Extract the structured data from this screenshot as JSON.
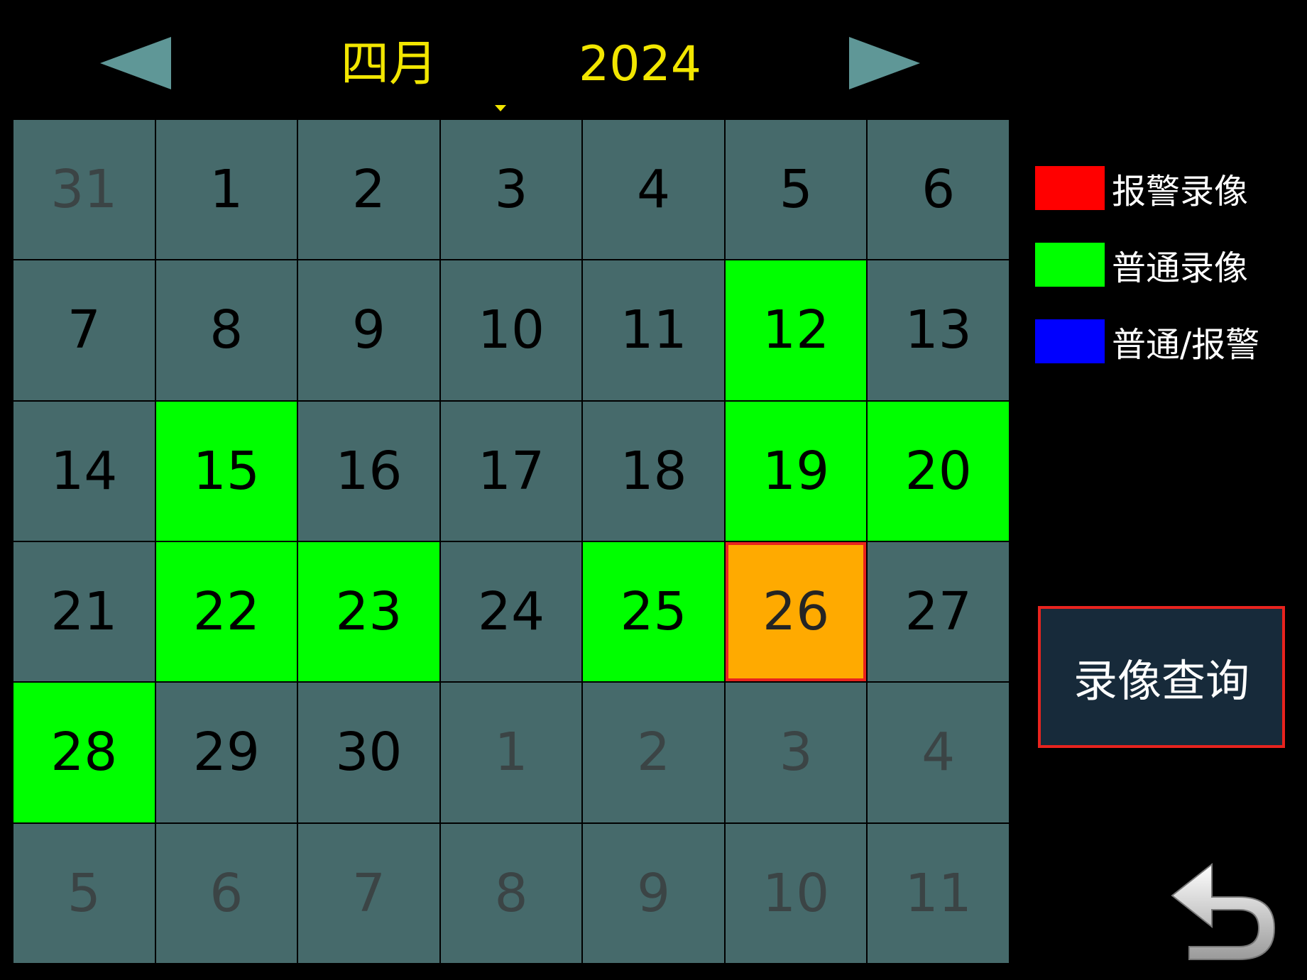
{
  "header": {
    "month": "四月",
    "year": "2024"
  },
  "calendar": {
    "cells": [
      {
        "day": "31",
        "state": "other"
      },
      {
        "day": "1",
        "state": "normal"
      },
      {
        "day": "2",
        "state": "normal"
      },
      {
        "day": "3",
        "state": "normal"
      },
      {
        "day": "4",
        "state": "normal"
      },
      {
        "day": "5",
        "state": "normal"
      },
      {
        "day": "6",
        "state": "normal"
      },
      {
        "day": "7",
        "state": "normal"
      },
      {
        "day": "8",
        "state": "normal"
      },
      {
        "day": "9",
        "state": "normal"
      },
      {
        "day": "10",
        "state": "normal"
      },
      {
        "day": "11",
        "state": "normal"
      },
      {
        "day": "12",
        "state": "recording"
      },
      {
        "day": "13",
        "state": "normal"
      },
      {
        "day": "14",
        "state": "normal"
      },
      {
        "day": "15",
        "state": "recording"
      },
      {
        "day": "16",
        "state": "normal"
      },
      {
        "day": "17",
        "state": "normal"
      },
      {
        "day": "18",
        "state": "normal"
      },
      {
        "day": "19",
        "state": "recording"
      },
      {
        "day": "20",
        "state": "recording"
      },
      {
        "day": "21",
        "state": "normal"
      },
      {
        "day": "22",
        "state": "recording"
      },
      {
        "day": "23",
        "state": "recording"
      },
      {
        "day": "24",
        "state": "normal"
      },
      {
        "day": "25",
        "state": "recording"
      },
      {
        "day": "26",
        "state": "selected"
      },
      {
        "day": "27",
        "state": "normal"
      },
      {
        "day": "28",
        "state": "recording"
      },
      {
        "day": "29",
        "state": "normal"
      },
      {
        "day": "30",
        "state": "normal"
      },
      {
        "day": "1",
        "state": "other"
      },
      {
        "day": "2",
        "state": "other"
      },
      {
        "day": "3",
        "state": "other"
      },
      {
        "day": "4",
        "state": "other"
      },
      {
        "day": "5",
        "state": "other"
      },
      {
        "day": "6",
        "state": "other"
      },
      {
        "day": "7",
        "state": "other"
      },
      {
        "day": "8",
        "state": "other"
      },
      {
        "day": "9",
        "state": "other"
      },
      {
        "day": "10",
        "state": "other"
      },
      {
        "day": "11",
        "state": "other"
      }
    ]
  },
  "legend": {
    "alarm": {
      "label": "报警录像",
      "color": "#ff0000"
    },
    "normal": {
      "label": "普通录像",
      "color": "#00ff00"
    },
    "mixed": {
      "label": "普通/报警",
      "color": "#0000ff"
    }
  },
  "query_button": {
    "label": "录像查询"
  },
  "icons": {
    "prev": "triangle-left-icon",
    "next": "triangle-right-icon",
    "back": "return-arrow-icon"
  },
  "colors": {
    "header_text": "#f2e600",
    "cell_bg": "#466a6b",
    "recording": "#00ff00",
    "selected": "#ffaa00",
    "selected_border": "#e8231e"
  }
}
